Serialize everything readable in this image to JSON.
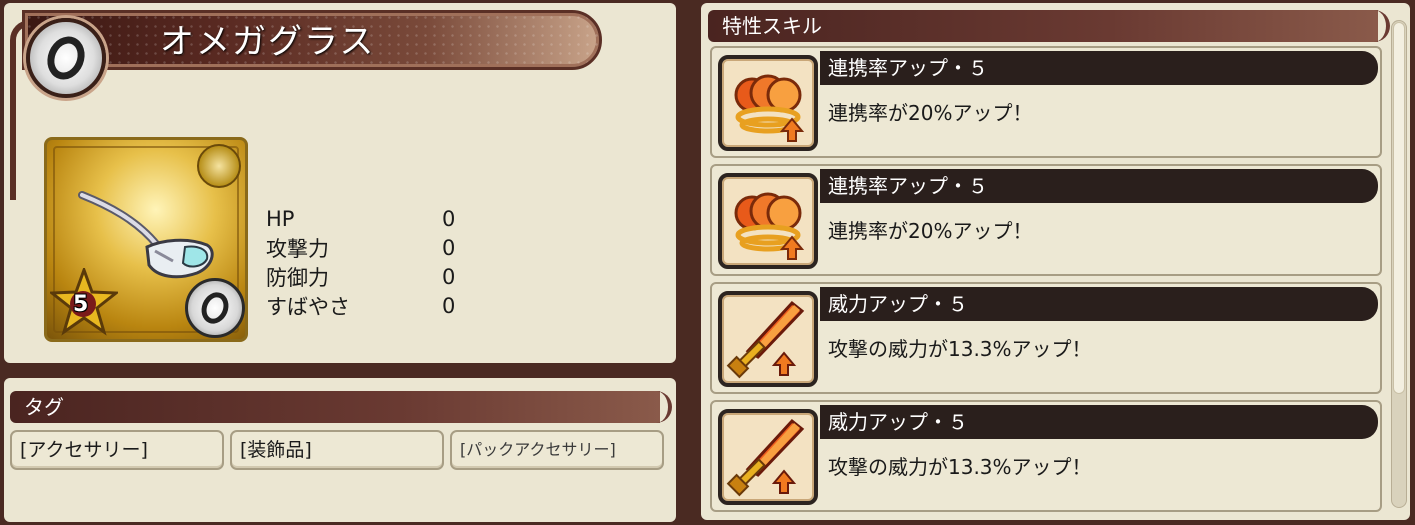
{
  "item": {
    "name": "オメガグラス",
    "rarity": "5",
    "stats": [
      {
        "label": "HP",
        "value": "0"
      },
      {
        "label": "攻撃力",
        "value": "0"
      },
      {
        "label": "防御力",
        "value": "0"
      },
      {
        "label": "すばやさ",
        "value": "0"
      }
    ]
  },
  "tags": {
    "header": "タグ",
    "items": [
      "[アクセサリー]",
      "[装飾品]",
      "[パックアクセサリー]"
    ]
  },
  "skills": {
    "header": "特性スキル",
    "items": [
      {
        "name": "連携率アップ・５",
        "description": "連携率が20%アップ！",
        "icon": "chain-rate-icon"
      },
      {
        "name": "連携率アップ・５",
        "description": "連携率が20%アップ！",
        "icon": "chain-rate-icon"
      },
      {
        "name": "威力アップ・５",
        "description": "攻撃の威力が13.3%アップ！",
        "icon": "power-sword-icon"
      },
      {
        "name": "威力アップ・５",
        "description": "攻撃の威力が13.3%アップ！",
        "icon": "power-sword-icon"
      }
    ]
  },
  "colors": {
    "background": "#4a2a22",
    "panel": "#ebe6d2",
    "header": "#4a2420",
    "card_gold": "#e7c04a"
  }
}
